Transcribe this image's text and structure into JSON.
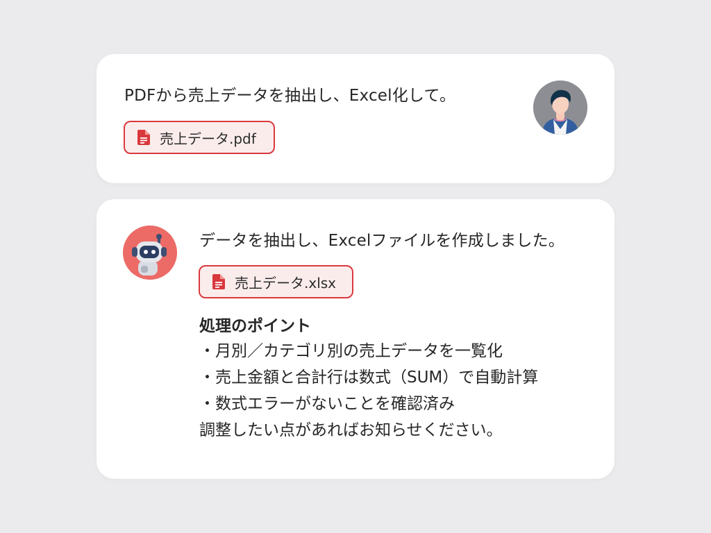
{
  "user_message": {
    "text": "PDFから売上データを抽出し、Excel化して。",
    "attachment": {
      "name": "売上データ.pdf",
      "icon": "document-icon"
    },
    "avatar": "user-avatar"
  },
  "assistant_message": {
    "text": "データを抽出し、Excelファイルを作成しました。",
    "attachment": {
      "name": "売上データ.xlsx",
      "icon": "document-icon"
    },
    "avatar": "robot-avatar",
    "points_title": "処理のポイント",
    "points": [
      "・月別／カテゴリ別の売上データを一覧化",
      "・売上金額と合計行は数式（SUM）で自動計算",
      "・数式エラーがないことを確認済み"
    ],
    "closing": "調整したい点があればお知らせください。"
  },
  "colors": {
    "background": "#ebebee",
    "card": "#ffffff",
    "chip_border": "#d9393d",
    "chip_fill": "#fbecec",
    "file_icon": "#d9393d",
    "robot_avatar_bg": "#ec6b67",
    "user_avatar_bg": "#8d8e93"
  }
}
